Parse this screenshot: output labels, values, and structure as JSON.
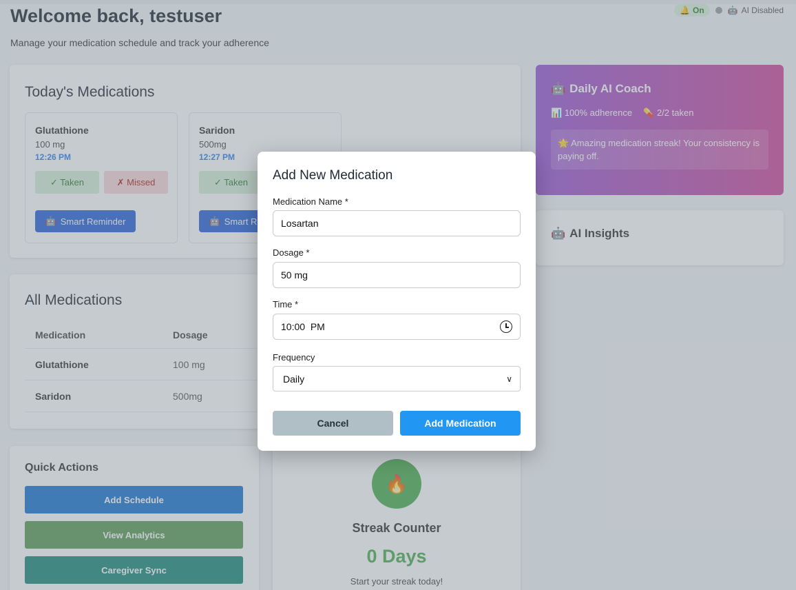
{
  "header": {
    "title": "Welcome back, testuser",
    "subtitle": "Manage your medication schedule and track your adherence",
    "on_label": "On",
    "ai_status": "AI Disabled"
  },
  "today": {
    "title": "Today's Medications",
    "meds": [
      {
        "name": "Glutathione",
        "dosage": "100 mg",
        "time": "12:26 PM"
      },
      {
        "name": "Saridon",
        "dosage": "500mg",
        "time": "12:27 PM"
      }
    ],
    "taken_label": "✓ Taken",
    "missed_label": "✗ Missed",
    "reminder_label": "Smart Reminder"
  },
  "all_meds": {
    "title": "All Medications",
    "columns": [
      "Medication",
      "Dosage"
    ],
    "rows": [
      {
        "name": "Glutathione",
        "dosage": "100 mg"
      },
      {
        "name": "Saridon",
        "dosage": "500mg"
      }
    ]
  },
  "quick_actions": {
    "title": "Quick Actions",
    "buttons": [
      {
        "label": "Add Schedule",
        "color": "#1976d2"
      },
      {
        "label": "View Analytics",
        "color": "#5e9e56"
      },
      {
        "label": "Caregiver Sync",
        "color": "#1e8a7a"
      }
    ]
  },
  "streak": {
    "title": "Streak Counter",
    "days": "0 Days",
    "message": "Start your streak today!"
  },
  "coach": {
    "title": "Daily AI Coach",
    "adherence": "100% adherence",
    "taken": "2/2 taken",
    "message": "Amazing medication streak! Your consistency is paying off."
  },
  "insights": {
    "title": "AI Insights"
  },
  "modal": {
    "title": "Add New Medication",
    "name_label": "Medication Name *",
    "name_value": "Losartan",
    "dosage_label": "Dosage *",
    "dosage_value": "50 mg",
    "time_label": "Time *",
    "time_value": "10:00  PM",
    "frequency_label": "Frequency",
    "frequency_value": "Daily",
    "cancel_label": "Cancel",
    "add_label": "Add Medication"
  }
}
